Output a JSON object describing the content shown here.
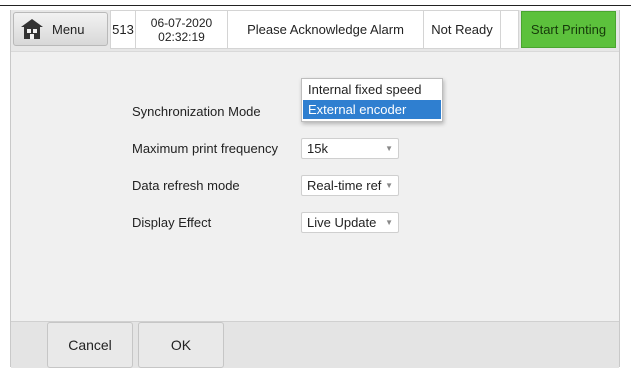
{
  "toolbar": {
    "menu_label": "Menu",
    "menu_icon": "home-icon",
    "counter": "513",
    "date": "06-07-2020",
    "time": "02:32:19",
    "alarm_text": "Please Acknowledge Alarm",
    "status_text": "Not Ready",
    "start_label": "Start Printing",
    "start_color": "#5cc13c"
  },
  "settings": {
    "rows": [
      {
        "label": "Synchronization Mode",
        "value": ""
      },
      {
        "label": "Maximum print frequency",
        "value": "15k"
      },
      {
        "label": "Data refresh mode",
        "value": "Real-time ref"
      },
      {
        "label": "Display Effect",
        "value": "Live Update"
      }
    ],
    "dropdown": {
      "options": [
        "Internal fixed speed",
        "External encoder"
      ],
      "selected_index": 1,
      "selected_color": "#2f7fd0"
    }
  },
  "footer": {
    "cancel_label": "Cancel",
    "ok_label": "OK"
  }
}
